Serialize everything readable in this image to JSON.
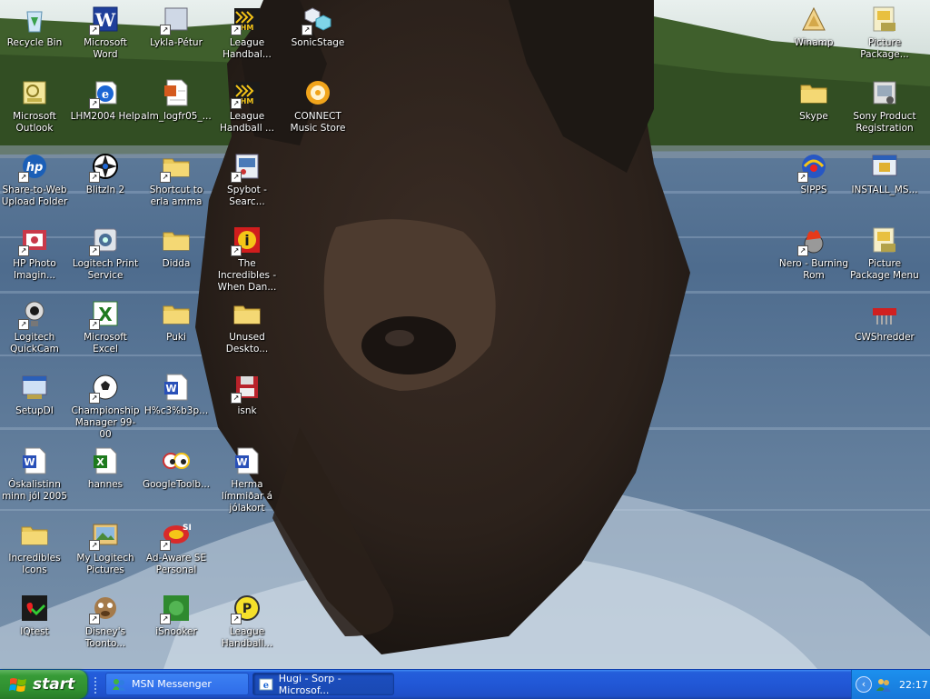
{
  "desktop": {
    "icons": [
      {
        "label": "Recycle Bin",
        "icon": "recycle-bin-icon",
        "shortcut": false
      },
      {
        "label": "Microsoft Word",
        "icon": "word-icon",
        "shortcut": true
      },
      {
        "label": "Lykla-Pétur",
        "icon": "app-icon",
        "shortcut": true
      },
      {
        "label": "League Handbal...",
        "icon": "handball-icon",
        "shortcut": true
      },
      {
        "label": "SonicStage",
        "icon": "sonicstage-icon",
        "shortcut": true
      },
      {
        "label": "Microsoft Outlook",
        "icon": "outlook-icon",
        "shortcut": false
      },
      {
        "label": "LHM2004 Help",
        "icon": "help-icon",
        "shortcut": true
      },
      {
        "label": "alm_logfr05_...",
        "icon": "document-icon",
        "shortcut": false
      },
      {
        "label": "League Handball ...",
        "icon": "handball-icon",
        "shortcut": true
      },
      {
        "label": "CONNECT Music Store",
        "icon": "connect-icon",
        "shortcut": false
      },
      {
        "label": "Share-to-Web Upload Folder",
        "icon": "hp-icon",
        "shortcut": true
      },
      {
        "label": "BlitzIn 2",
        "icon": "blitzin-icon",
        "shortcut": true
      },
      {
        "label": "Shortcut to erla amma",
        "icon": "folder-icon",
        "shortcut": true
      },
      {
        "label": "Spybot - Searc...",
        "icon": "spybot-icon",
        "shortcut": true
      },
      {
        "label": "HP Photo Imagin...",
        "icon": "hp-photo-icon",
        "shortcut": true
      },
      {
        "label": "Logitech Print Service",
        "icon": "logitech-print-icon",
        "shortcut": true
      },
      {
        "label": "Didda",
        "icon": "folder-icon",
        "shortcut": false
      },
      {
        "label": "The Incredibles - When Dan...",
        "icon": "incredibles-icon",
        "shortcut": true
      },
      {
        "label": "Logitech QuickCam",
        "icon": "webcam-icon",
        "shortcut": true
      },
      {
        "label": "Microsoft Excel",
        "icon": "excel-icon",
        "shortcut": true
      },
      {
        "label": "Puki",
        "icon": "folder-icon",
        "shortcut": false
      },
      {
        "label": "Unused Deskto...",
        "icon": "folder-icon",
        "shortcut": false
      },
      {
        "label": "SetupDI",
        "icon": "setup-icon",
        "shortcut": false
      },
      {
        "label": "Championship Manager 99-00",
        "icon": "football-icon",
        "shortcut": true
      },
      {
        "label": "H%c3%b3p...",
        "icon": "word-doc-icon",
        "shortcut": false
      },
      {
        "label": "isnk",
        "icon": "floppy-icon",
        "shortcut": true
      },
      {
        "label": "Óskalistinn minn jól 2005",
        "icon": "word-doc-icon",
        "shortcut": false
      },
      {
        "label": "hannes",
        "icon": "excel-doc-icon",
        "shortcut": false
      },
      {
        "label": "GoogleToolb...",
        "icon": "google-eyes-icon",
        "shortcut": false
      },
      {
        "label": "Herma límmiðar á jólakort",
        "icon": "word-doc-icon",
        "shortcut": false
      },
      {
        "label": "Incredibles Icons",
        "icon": "folder-icon",
        "shortcut": false
      },
      {
        "label": "My Logitech Pictures",
        "icon": "pictures-icon",
        "shortcut": true
      },
      {
        "label": "Ad-Aware SE Personal",
        "icon": "adaware-icon",
        "shortcut": true
      },
      {
        "label": "IQtest",
        "icon": "iqtest-icon",
        "shortcut": false
      },
      {
        "label": "Disney's Toonto...",
        "icon": "toontown-icon",
        "shortcut": true
      },
      {
        "label": "iSnooker",
        "icon": "snooker-icon",
        "shortcut": true
      },
      {
        "label": "League Handball...",
        "icon": "league-p-icon",
        "shortcut": true
      },
      {
        "label": "Winamp",
        "icon": "winamp-icon",
        "shortcut": false
      },
      {
        "label": "Picture Package...",
        "icon": "picture-package-icon",
        "shortcut": false
      },
      {
        "label": "Skype",
        "icon": "folder-icon",
        "shortcut": false
      },
      {
        "label": "Sony Product Registration",
        "icon": "sony-reg-icon",
        "shortcut": false
      },
      {
        "label": "SIPPS",
        "icon": "sipps-icon",
        "shortcut": true
      },
      {
        "label": "INSTALL_MS...",
        "icon": "installer-icon",
        "shortcut": false
      },
      {
        "label": "Nero - Burning Rom",
        "icon": "nero-icon",
        "shortcut": true
      },
      {
        "label": "Picture Package Menu",
        "icon": "picture-package-icon",
        "shortcut": false
      },
      {
        "label": "CWShredder",
        "icon": "shredder-icon",
        "shortcut": false
      }
    ]
  },
  "taskbar": {
    "start_label": "start",
    "tasks": [
      {
        "label": "MSN Messenger",
        "icon": "msn-icon",
        "active": false
      },
      {
        "label": "Hugi - Sorp - Microsof...",
        "icon": "ie-icon",
        "active": true
      }
    ],
    "clock": "22:17"
  },
  "colors": {
    "taskbar": "#245edb",
    "start": "#379b37",
    "tray": "#1777d9"
  }
}
